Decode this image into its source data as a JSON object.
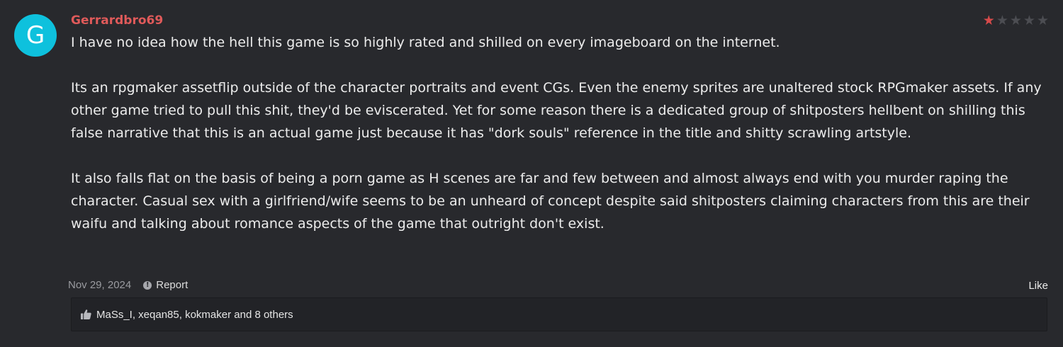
{
  "review": {
    "avatar_letter": "G",
    "avatar_color": "#0ec1dd",
    "author": "Gerrardbro69",
    "author_color": "#e05a5a",
    "rating": 1,
    "max_rating": 5,
    "paragraphs": [
      "I have no idea how the hell this game is so highly rated and shilled on every imageboard on the internet.",
      "Its an rpgmaker assetflip outside of the character portraits and event CGs. Even the enemy sprites are unaltered stock RPGmaker assets. If any other game tried to pull this shit, they'd be eviscerated. Yet for some reason there is a dedicated group of shitposters hellbent on shilling this false narrative that this is an actual game just because it has \"dork souls\" reference in the title and shitty scrawling artstyle.",
      "It also falls flat on the basis of being a porn game as H scenes are far and few between and almost always end with you murder raping the character. Casual sex with a girlfriend/wife seems to be an unheard of concept despite said shitposters claiming characters from this are their waifu and talking about romance aspects of the game that outright don't exist."
    ],
    "date": "Nov 29, 2024",
    "report_label": "Report",
    "report_icon": "info-circle-icon",
    "like_label": "Like",
    "likes_summary": "MaSs_I, xeqan85, kokmaker and 8 others",
    "likes_icon": "thumbs-up-icon"
  }
}
